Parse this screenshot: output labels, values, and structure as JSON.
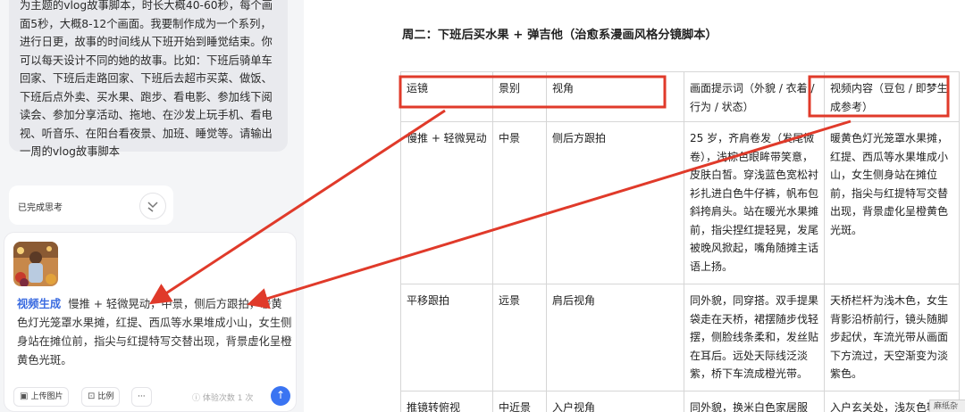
{
  "chat": {
    "user_prompt": "为主题的vlog故事脚本，时长大概40-60秒，每个画\n面5秒，大概8-12个画面。我要制作成为一个系列，\n进行日更，故事的时间线从下班开始到睡觉结束。你\n可以每天设计不同的她的故事。比如：下班后骑单车\n回家、下班后走路回家、下班后去超市买菜、做饭、\n下班后点外卖、买水果、跑步、看电影、参加线下阅\n读会、参加分享活动、拖地、在沙发上玩手机、看电\n视、听音乐、在阳台看夜景、加班、睡觉等。请输出\n一周的vlog故事脚本",
    "thinking_status": "已完成思考",
    "generation_label": "视频生成",
    "generation_prompt": "慢推 + 轻微晃动，中景，侧后方跟拍，暖黄色灯光笼罩水果摊，红提、西瓜等水果堆成小山，女生侧身站在摊位前，指尖与红提特写交替出现，背景虚化呈橙黄色光斑。",
    "toolbar": {
      "upload_label": "上传图片",
      "ratio_label": "比例",
      "more_label": "···",
      "usage_text": "体验次数 1 次"
    }
  },
  "document": {
    "title": "周二：下班后买水果 + 弹吉他（治愈系漫画风格分镜脚本）",
    "headers": [
      "运镜",
      "景别",
      "视角",
      "画面提示词（外貌 / 衣着 / 行为 / 状态）",
      "视频内容（豆包 / 即梦生成参考）"
    ],
    "rows": [
      [
        "慢推 + 轻微晃动",
        "中景",
        "侧后方跟拍",
        "25 岁，齐肩卷发（发尾微卷），浅棕色眼眸带笑意，皮肤白皙。穿浅蓝色宽松衬衫扎进白色牛仔裤，帆布包斜挎肩头。站在暖光水果摊前，指尖捏红提轻晃，发尾被晚风掀起，嘴角随摊主话语上扬。",
        "暖黄色灯光笼罩水果摊，红提、西瓜等水果堆成小山，女生侧身站在摊位前，指尖与红提特写交替出现，背景虚化呈橙黄色光斑。"
      ],
      [
        "平移跟拍",
        "远景",
        "肩后视角",
        "同外貌，同穿搭。双手提果袋走在天桥，裙摆随步伐轻摆，侧脸线条柔和，发丝贴在耳后。远处天际线泛淡紫，桥下车流成橙光带。",
        "天桥栏杆为浅木色，女生背影沿桥前行，镜头随脚步起伏，车流光带从画面下方流过，天空渐变为淡紫色。"
      ],
      [
        "推镜转俯视",
        "中近景",
        "入户视角",
        "同外貌，换米白色家居服",
        "入户玄关处，浅灰色鞋"
      ]
    ],
    "corner_tag": "麻纸杂"
  },
  "annotations": {
    "highlight_color": "#e03a2a"
  }
}
